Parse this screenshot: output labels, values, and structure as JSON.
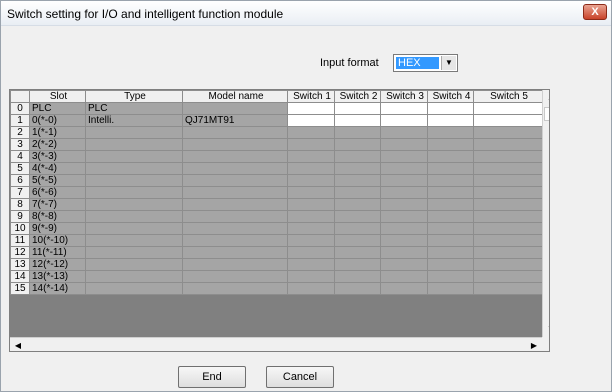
{
  "window": {
    "title": "Switch setting for I/O and intelligent function module",
    "close_label": "X"
  },
  "input_format": {
    "label": "Input format",
    "value": "HEX"
  },
  "grid": {
    "columns": [
      "",
      "Slot",
      "Type",
      "Model name",
      "Switch 1",
      "Switch 2",
      "Switch 3",
      "Switch 4",
      "Switch 5"
    ],
    "rows": [
      {
        "index": "0",
        "slot": "PLC",
        "type": "PLC",
        "model": ""
      },
      {
        "index": "1",
        "slot": "0(*-0)",
        "type": "Intelli.",
        "model": "QJ71MT91"
      },
      {
        "index": "2",
        "slot": "1(*-1)",
        "type": "",
        "model": ""
      },
      {
        "index": "3",
        "slot": "2(*-2)",
        "type": "",
        "model": ""
      },
      {
        "index": "4",
        "slot": "3(*-3)",
        "type": "",
        "model": ""
      },
      {
        "index": "5",
        "slot": "4(*-4)",
        "type": "",
        "model": ""
      },
      {
        "index": "6",
        "slot": "5(*-5)",
        "type": "",
        "model": ""
      },
      {
        "index": "7",
        "slot": "6(*-6)",
        "type": "",
        "model": ""
      },
      {
        "index": "8",
        "slot": "7(*-7)",
        "type": "",
        "model": ""
      },
      {
        "index": "9",
        "slot": "8(*-8)",
        "type": "",
        "model": ""
      },
      {
        "index": "10",
        "slot": "9(*-9)",
        "type": "",
        "model": ""
      },
      {
        "index": "11",
        "slot": "10(*-10)",
        "type": "",
        "model": ""
      },
      {
        "index": "12",
        "slot": "11(*-11)",
        "type": "",
        "model": ""
      },
      {
        "index": "13",
        "slot": "12(*-12)",
        "type": "",
        "model": ""
      },
      {
        "index": "14",
        "slot": "13(*-13)",
        "type": "",
        "model": ""
      },
      {
        "index": "15",
        "slot": "14(*-14)",
        "type": "",
        "model": ""
      }
    ],
    "editable_rows": [
      "0",
      "1"
    ]
  },
  "buttons": {
    "end": "End",
    "cancel": "Cancel"
  },
  "colors": {
    "disabled_cell": "#a5a5a5",
    "editable_cell": "#ffffff",
    "selection": "#3399ff"
  }
}
